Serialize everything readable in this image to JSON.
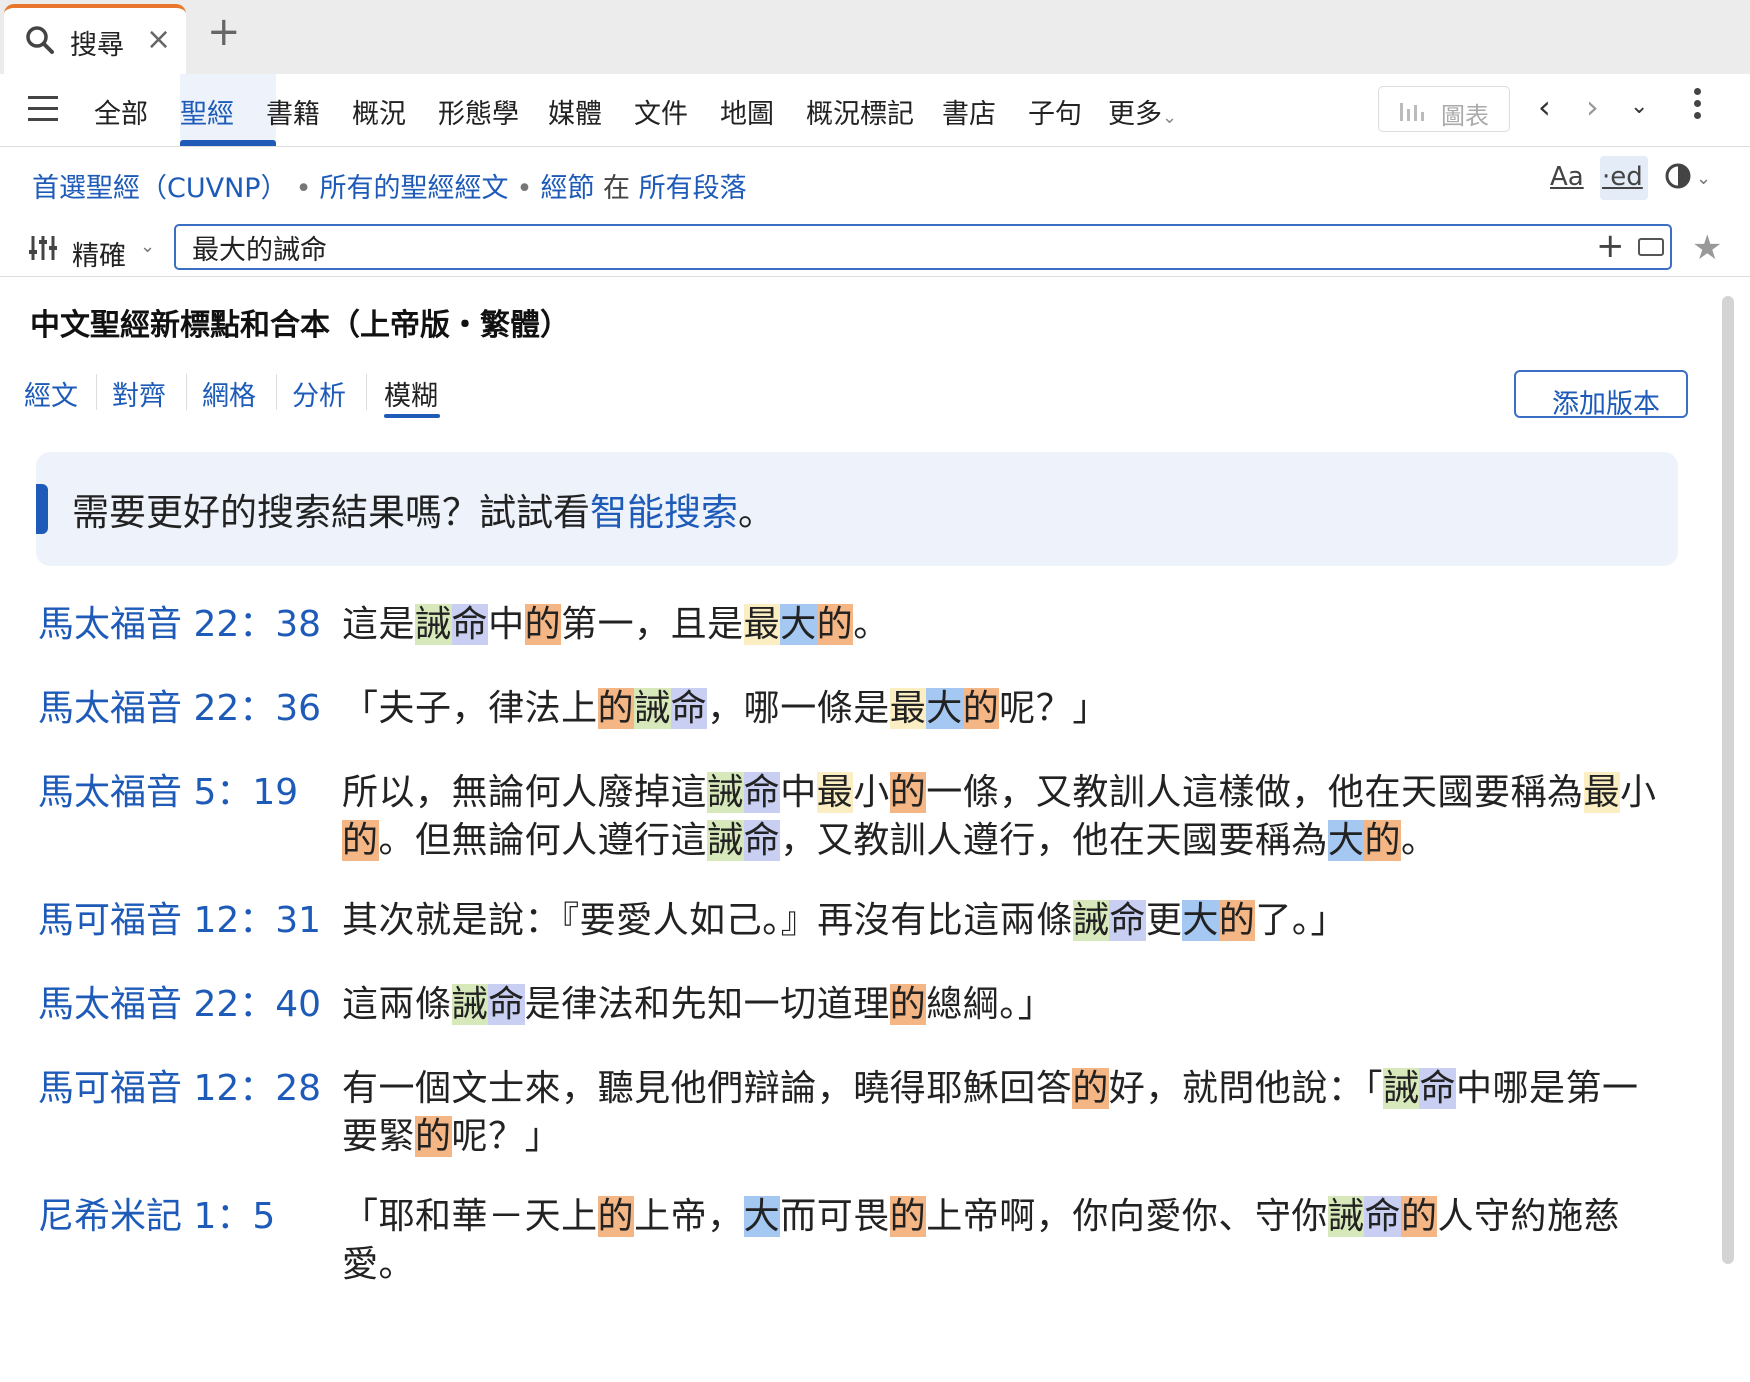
{
  "tabbar": {
    "tab_label": "搜尋",
    "accent": "#e8762c"
  },
  "nav": {
    "items": [
      "全部",
      "聖經",
      "書籍",
      "概況",
      "形態學",
      "媒體",
      "文件",
      "地圖",
      "概況標記",
      "書店",
      "子句",
      "更多"
    ],
    "active_index": 1,
    "chart_label": "圖表"
  },
  "scope": {
    "preferred_bible": "首選聖經（CUVNP）",
    "all_verses": "所有的聖經經文",
    "verses": "經節",
    "in": "在",
    "all_passages": "所有段落",
    "font_btn": "Aa",
    "ed_btn": "·ed"
  },
  "search": {
    "mode": "精確",
    "query": "最大的誡命"
  },
  "content": {
    "book_title": "中文聖經新標點和合本（上帝版・繁體）",
    "view_tabs": [
      "經文",
      "對齊",
      "網格",
      "分析",
      "模糊"
    ],
    "active_view": "模糊",
    "add_version": "添加版本",
    "callout_prefix": "需要更好的搜索結果嗎？試試看",
    "callout_link": "智能搜索",
    "callout_suffix": "。"
  },
  "highlight_colors": {
    "最": "#fbeec3",
    "大": "#a5c8f3",
    "的": "#f4b684",
    "誡": "#d7e8bb",
    "命": "#c8cff3"
  },
  "results": [
    {
      "ref": "馬太福音 22：38",
      "text": "這是誡命中的第一，且是最大的。"
    },
    {
      "ref": "馬太福音 22：36",
      "text": "「夫子，律法上的誡命，哪一條是最大的呢？」"
    },
    {
      "ref": "馬太福音 5：19",
      "text": "所以，無論何人廢掉這誡命中最小的一條，又教訓人這樣做，他在天國要稱為最小的。但無論何人遵行這誡命，又教訓人遵行，他在天國要稱為大的。"
    },
    {
      "ref": "馬可福音 12：31",
      "text": "其次就是說：『要愛人如己。』再沒有比這兩條誡命更大的了。」"
    },
    {
      "ref": "馬太福音 22：40",
      "text": "這兩條誡命是律法和先知一切道理的總綱。」"
    },
    {
      "ref": "馬可福音 12：28",
      "text": "有一個文士來，聽見他們辯論，曉得耶穌回答的好，就問他說：「誡命中哪是第一要緊的呢？」"
    },
    {
      "ref": "尼希米記 1：5",
      "text": "「耶和華－天上的上帝，大而可畏的上帝啊，你向愛你、守你誡命的人守約施慈愛。"
    }
  ]
}
